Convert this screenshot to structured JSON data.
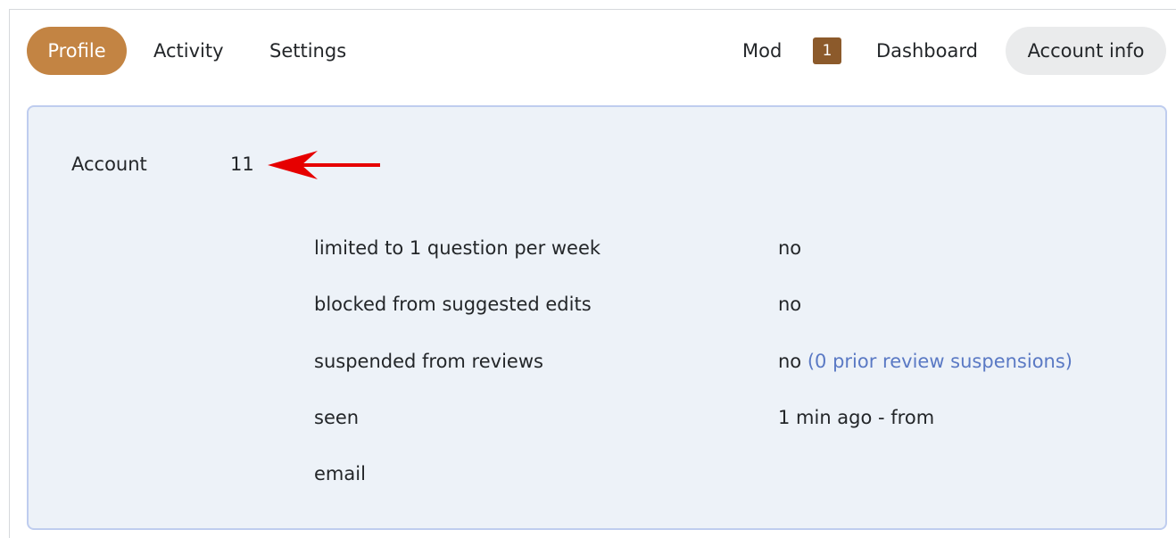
{
  "nav": {
    "left_tabs": [
      "Profile",
      "Activity",
      "Settings"
    ],
    "mod_label": "Mod",
    "mod_badge": "1",
    "dashboard": "Dashboard",
    "account_info": "Account info"
  },
  "panel": {
    "account_label": "Account",
    "account_value": "11",
    "rows": [
      {
        "label": "limited to 1 question per week",
        "value": "no"
      },
      {
        "label": "blocked from suggested edits",
        "value": "no"
      },
      {
        "label": "suspended from reviews",
        "value": "no",
        "link": "(0 prior review suspensions)"
      },
      {
        "label": "seen",
        "value": "1 min ago - from"
      },
      {
        "label": "email",
        "value": ""
      }
    ]
  },
  "colors": {
    "active_tab": "#c38443",
    "badge": "#8c5a2b",
    "panel_bg": "#edf2f8",
    "panel_border": "#bfcdef",
    "link": "#5a79c4",
    "annotation_arrow": "#e60000"
  },
  "icons": {
    "annotation": "red-arrow-icon"
  }
}
